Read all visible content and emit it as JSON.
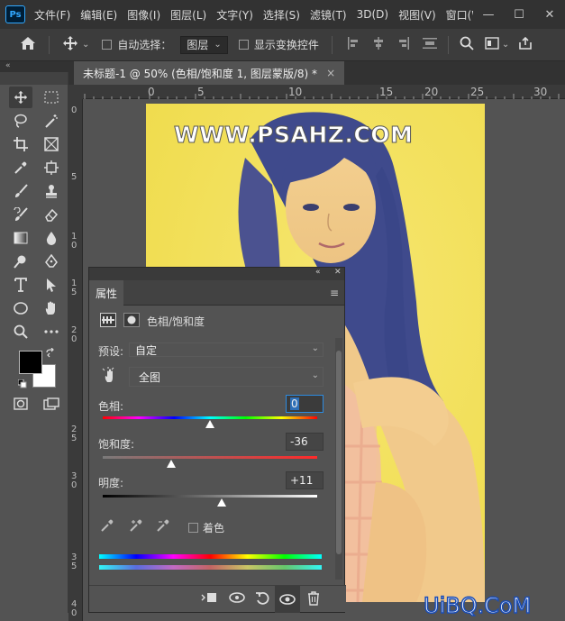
{
  "app": {
    "logo": "Ps"
  },
  "menu": {
    "items": [
      "文件(F)",
      "编辑(E)",
      "图像(I)",
      "图层(L)",
      "文字(Y)",
      "选择(S)",
      "滤镜(T)",
      "3D(D)",
      "视图(V)",
      "窗口(W"
    ]
  },
  "window_controls": {
    "minimize": "—",
    "maximize": "☐",
    "close": "✕"
  },
  "options_bar": {
    "auto_select_label": "自动选择：",
    "auto_select_value": "图层",
    "show_transform_label": "显示变换控件"
  },
  "doc_tab": {
    "title": "未标题-1 @ 50% (色相/饱和度 1, 图层蒙版/8) *",
    "close": "×"
  },
  "ruler_h": [
    "0",
    "5",
    "10",
    "15",
    "20",
    "25",
    "30"
  ],
  "ruler_v": [
    "0",
    "5",
    "1\n0",
    "1\n5",
    "2\n0",
    "2\n5",
    "3\n0",
    "3\n5",
    "4\n0"
  ],
  "properties": {
    "tab_label": "属性",
    "adjustment_title": "色相/饱和度",
    "preset_label": "预设:",
    "preset_value": "自定",
    "range_value": "全图",
    "hue": {
      "label": "色相:",
      "value": "0",
      "level": 0.5
    },
    "saturation": {
      "label": "饱和度:",
      "value": "-36",
      "level": 0.32
    },
    "lightness": {
      "label": "明度:",
      "value": "+11",
      "level": 0.555
    },
    "colorize_label": "着色"
  },
  "watermarks": {
    "top": "WWW.PSAHZ.COM",
    "bottom": "UiBQ.CoM"
  },
  "colors": {
    "doc_background": "#f3e157",
    "accent": "#31a8ff"
  }
}
